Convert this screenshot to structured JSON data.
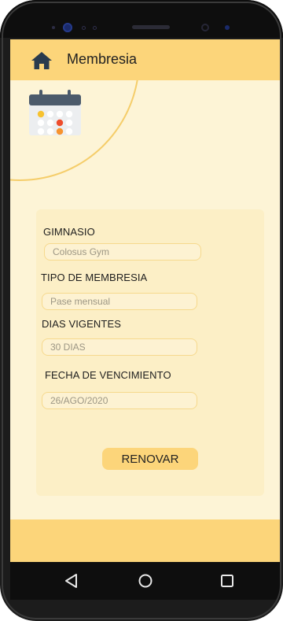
{
  "header": {
    "title": "Membresia",
    "home_icon": "home-icon"
  },
  "decor": {
    "calendar_icon": "calendar-icon"
  },
  "form": {
    "gym": {
      "label": "GIMNASIO",
      "placeholder": "Colosus Gym"
    },
    "membership_type": {
      "label": "TIPO DE MEMBRESIA",
      "placeholder": "Pase mensual"
    },
    "valid_days": {
      "label": "DIAS VIGENTES",
      "placeholder": "30 DIAS"
    },
    "expiry_date": {
      "label": "FECHA DE VENCIMIENTO",
      "placeholder": "26/AGO/2020"
    },
    "renew_button": "RENOVAR"
  },
  "nav": {
    "back_icon": "back-triangle-icon",
    "home_icon": "home-circle-icon",
    "recents_icon": "recents-square-icon"
  },
  "colors": {
    "header": "#fcd57a",
    "background": "#fdf4d6",
    "card": "#fcefc6",
    "input_border": "#f6d98d",
    "button": "#fcd57a"
  }
}
